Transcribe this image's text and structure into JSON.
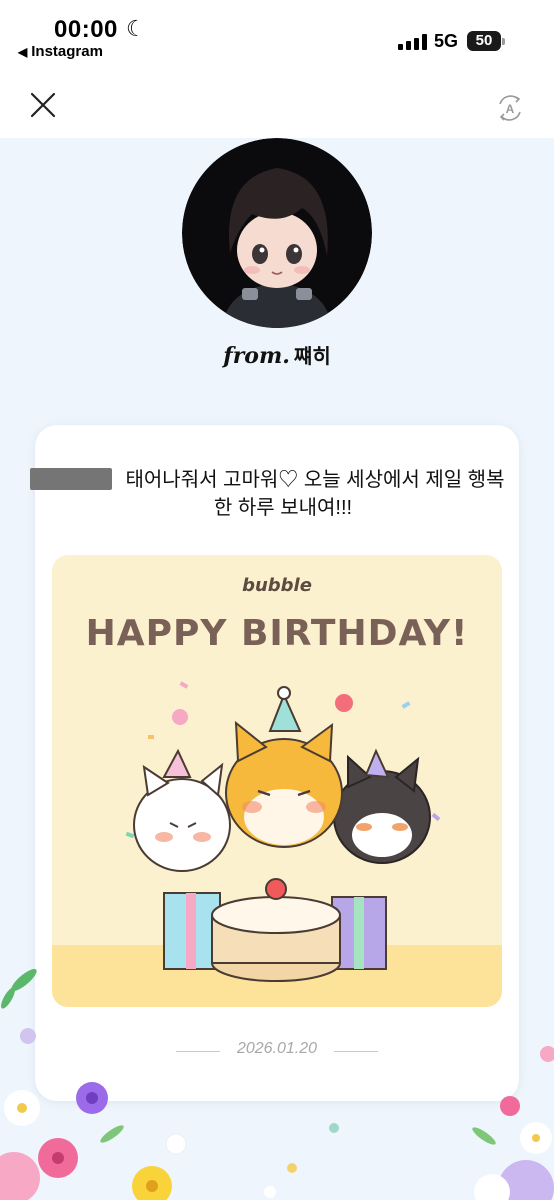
{
  "status_bar": {
    "time": "00:00",
    "back_app": "Instagram",
    "network": "5G",
    "battery": "50"
  },
  "nav": {
    "close_icon": "close-icon",
    "translate_icon": "translate-icon"
  },
  "profile": {
    "from_prefix": "from.",
    "name": "쨰히"
  },
  "message": {
    "text": "태어나줘서 고마워♡ 오늘 세상에서 제일 행복한 하루 보내여!!!"
  },
  "card_image": {
    "logo": "bubble",
    "title": "HAPPY BIRTHDAY!"
  },
  "date": "2026.01.20",
  "colors": {
    "background": "#eef5fc",
    "card_image_bg": "#fbf1cf",
    "title_brown": "#7a6157"
  }
}
